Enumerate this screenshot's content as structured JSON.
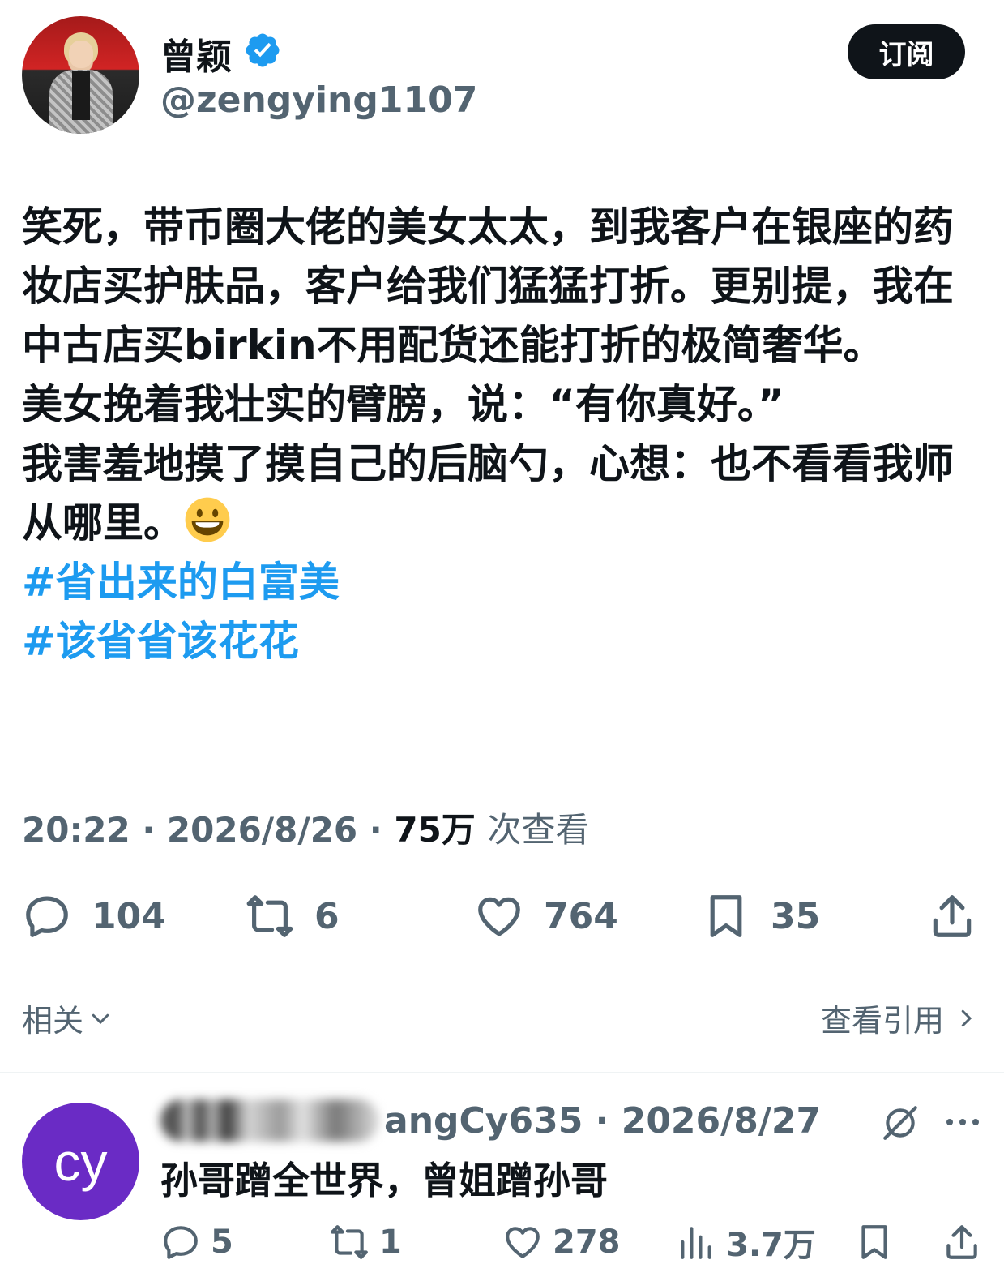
{
  "author": {
    "name": "曾颖",
    "handle": "@zengying1107",
    "subscribe_label": "订阅"
  },
  "tweet": {
    "text": "笑死，带币圈大佬的美女太太，到我客户在银座的药妆店买护肤品，客户给我们猛猛打折。更别提，我在中古店买birkin不用配货还能打折的极简奢华。\n美女挽着我壮实的臂膀，说：“有你真好。”\n我害羞地摸了摸自己的后脑勺，心想：也不看看我师从哪里。",
    "hashtags": [
      "#省出来的白富美",
      "#该省省该花花"
    ],
    "time": "20:22",
    "date": "2026/8/26",
    "views": "75万",
    "views_label": "次查看",
    "replies": "104",
    "reposts": "6",
    "likes": "764",
    "bookmarks": "35"
  },
  "tabs": {
    "related": "相关",
    "view_quotes": "查看引用"
  },
  "reply": {
    "avatar_text": "cy",
    "handle_suffix": "angCy635",
    "date": "2026/8/27",
    "text": "孙哥蹭全世界，曾姐蹭孙哥",
    "replies": "5",
    "reposts": "1",
    "likes": "278",
    "views": "3.7万"
  },
  "colors": {
    "accent": "#1d9bf0",
    "text": "#0f1419",
    "muted": "#536471",
    "reply_avatar": "#6a2bc5"
  }
}
